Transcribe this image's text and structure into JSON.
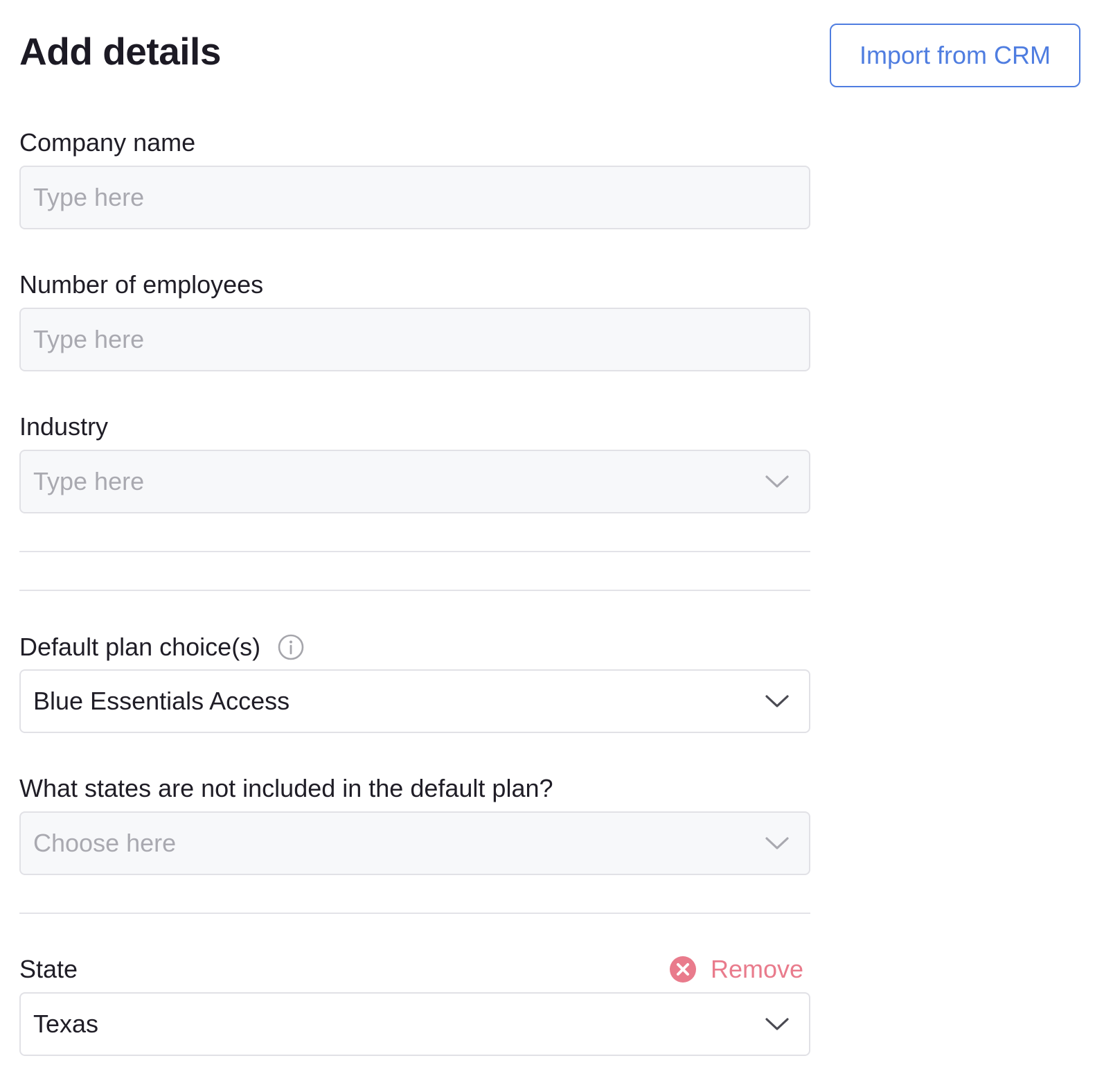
{
  "header": {
    "title": "Add details",
    "import_button": "Import from CRM"
  },
  "fields": {
    "company_name": {
      "label": "Company name",
      "placeholder": "Type here",
      "value": ""
    },
    "employees": {
      "label": "Number of employees",
      "placeholder": "Type here",
      "value": ""
    },
    "industry": {
      "label": "Industry",
      "placeholder": "Type here",
      "icon": "chevron-down-icon"
    },
    "default_plan": {
      "label": "Default plan choice(s)",
      "value": "Blue Essentials Access",
      "info_icon": "info-icon",
      "icon": "chevron-down-icon"
    },
    "excluded_states": {
      "label": "What states are not included in the default plan?",
      "placeholder": "Choose here",
      "icon": "chevron-down-icon"
    },
    "state": {
      "label": "State",
      "value": "Texas",
      "remove_label": "Remove",
      "remove_icon": "close-circle-icon",
      "icon": "chevron-down-icon"
    }
  },
  "colors": {
    "accent": "#4f7de0",
    "danger": "#e97b8c",
    "text": "#1f1d26",
    "placeholder": "#a9a9b0",
    "input_bg": "#f7f8fa",
    "border": "#e1e1e6"
  }
}
